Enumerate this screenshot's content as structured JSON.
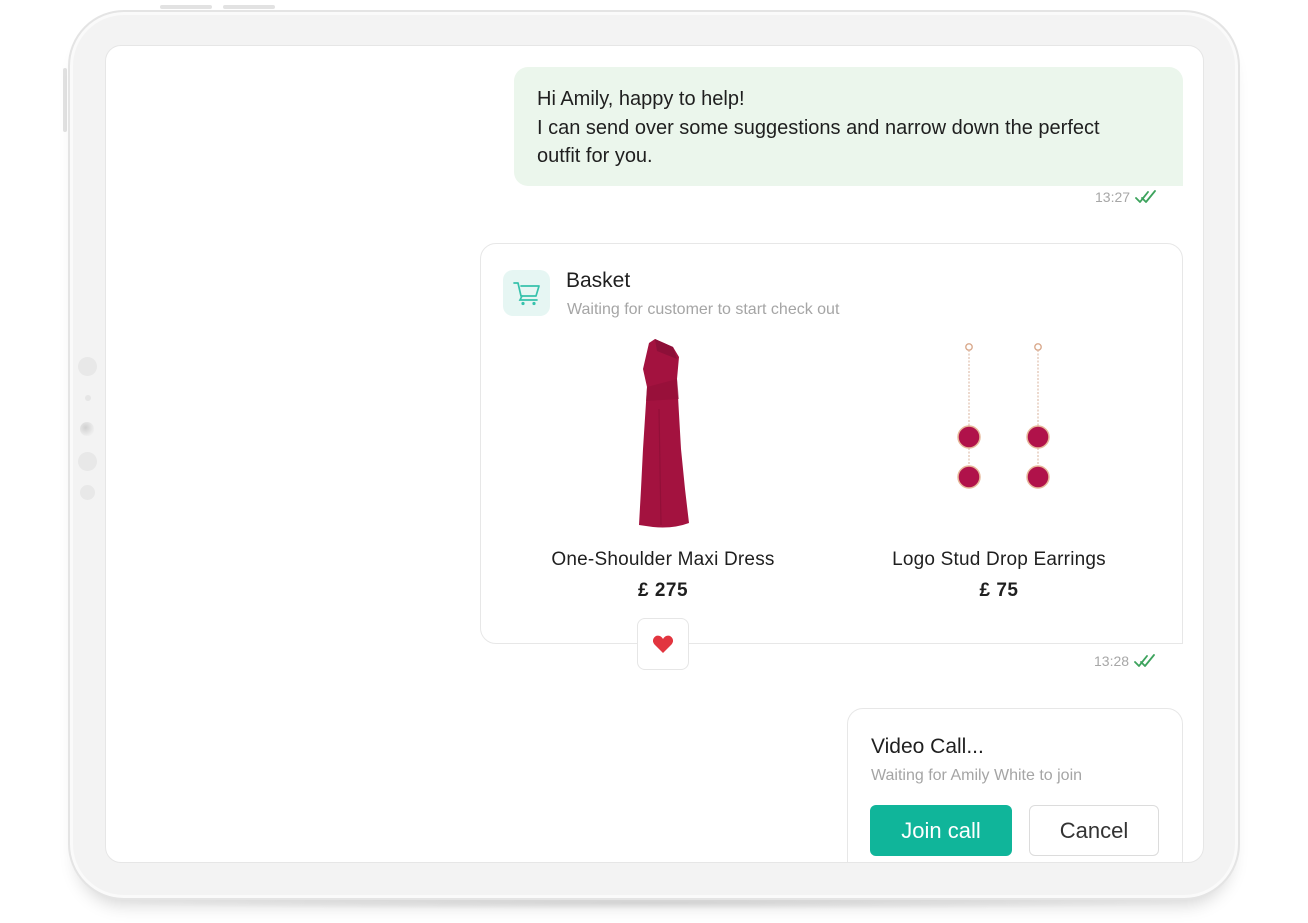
{
  "colors": {
    "accent": "#10b59a",
    "bubble_bg": "#ebf6ec",
    "read_check": "#3da35d",
    "heart": "#e2353f",
    "product": "#b0124a"
  },
  "chat": {
    "outgoing_message": {
      "lines": [
        "Hi Amily, happy to help!",
        "I can send over some suggestions and narrow down the perfect",
        "outfit for you."
      ],
      "time": "13:27",
      "status_icon": "double-check-icon"
    },
    "basket": {
      "icon": "cart-icon",
      "title": "Basket",
      "subtitle": "Waiting for customer to start check out",
      "products": [
        {
          "name": "One-Shoulder Maxi Dress",
          "price": "£ 275",
          "image": "dress-image",
          "favorited": true
        },
        {
          "name": "Logo Stud Drop Earrings",
          "price": "£ 75",
          "image": "earrings-image",
          "favorited": false
        }
      ],
      "favorite_icon": "heart-icon",
      "time": "13:28",
      "status_icon": "double-check-icon"
    },
    "video_call": {
      "title": "Video Call...",
      "subtitle": "Waiting for Amily White to join",
      "join_label": "Join call",
      "cancel_label": "Cancel"
    }
  }
}
